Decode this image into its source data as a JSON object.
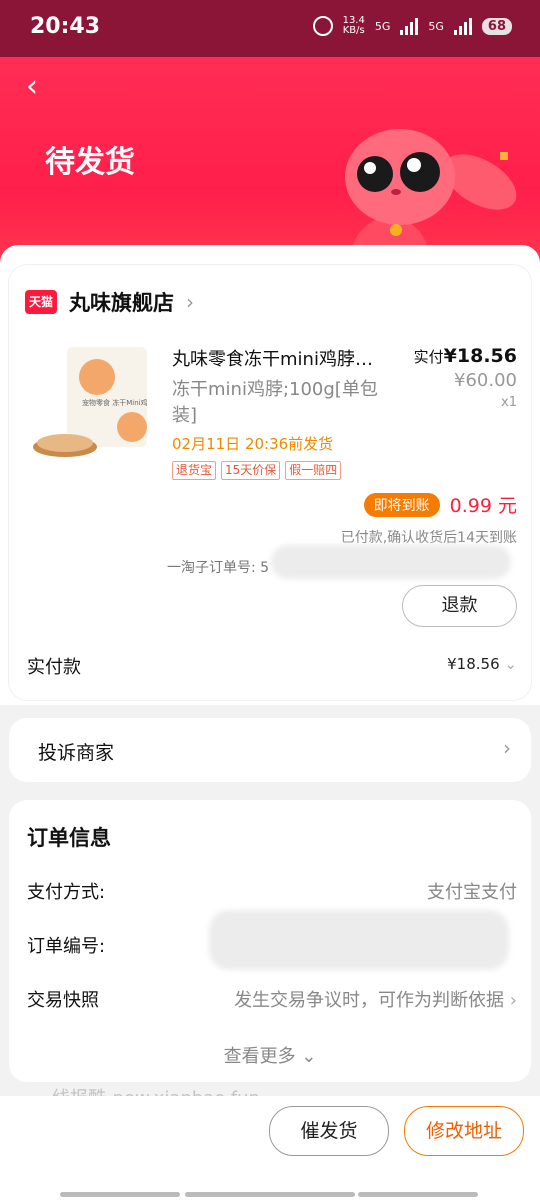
{
  "status_bar": {
    "time": "20:43",
    "net_speed_top": "13.4",
    "net_speed_unit": "KB/s",
    "sim1": "5G",
    "sim2": "5G",
    "battery": "68"
  },
  "header": {
    "title": "待发货"
  },
  "store": {
    "name": "丸味旗舰店",
    "platform_badge": "天猫",
    "product": {
      "title": "丸味零食冻干mini鸡脖…",
      "spec": "冻干mini鸡脖;100g[单包装]",
      "ship_time": "02月11日 20:36前发货",
      "tags": [
        "退货宝",
        "15天价保",
        "假一赔四"
      ],
      "paid_label": "实付",
      "paid_price": "¥18.56",
      "original_price": "¥60.00",
      "quantity": "x1",
      "image_text": "宠物零食 冻干Mini鸡脖"
    },
    "cashback_badge": "即将到账",
    "cashback_amount": "0.99 元",
    "cashback_note": "已付款,确认收货后14天到账",
    "taozi_order": "一淘子订单号: 5",
    "refund_button": "退款",
    "total_label": "实付款",
    "total_value": "¥18.56"
  },
  "complain": {
    "label": "投诉商家"
  },
  "order_info": {
    "title": "订单信息",
    "rows": [
      {
        "label": "支付方式:",
        "value": "支付宝支付"
      },
      {
        "label": "订单编号:",
        "value": ""
      },
      {
        "label": "交易快照",
        "value": "发生交易争议时，可作为判断依据"
      }
    ],
    "more": "查看更多"
  },
  "watermark": "线报酷-new.xianbao.fun",
  "actions": {
    "urge": "催发货",
    "modify_address": "修改地址"
  },
  "colors": {
    "brand_red": "#ff2d55",
    "accent_orange": "#f57c00",
    "price_red": "#ff1f3d"
  }
}
